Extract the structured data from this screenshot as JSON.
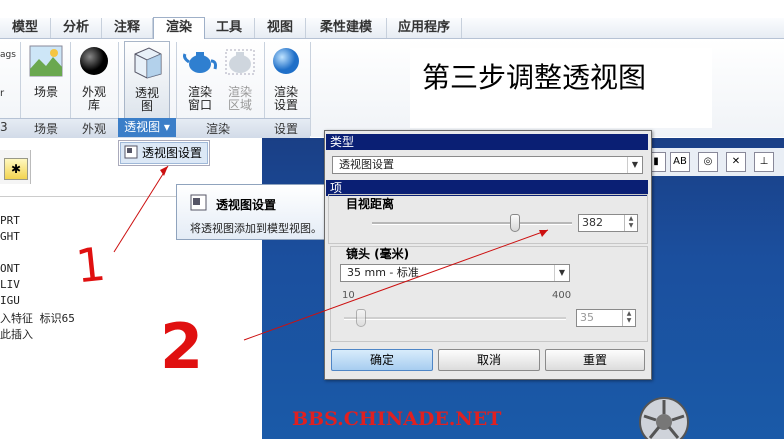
{
  "ribbon_tabs": [
    "模型",
    "分析",
    "注释",
    "渲染",
    "工具",
    "视图",
    "柔性建模",
    "应用程序"
  ],
  "ribbon_buttons": {
    "scene": "场景",
    "appearance": "外观\n库",
    "perspective": "透视\n图",
    "render_window": "渲染\n窗口",
    "render_region": "渲染\n区域",
    "render_settings": "渲染\n设置"
  },
  "left_edge_fragments": {
    "ags": "ags",
    "r": "r",
    "num": "3"
  },
  "group_labels": {
    "scene": "场景",
    "appearance": "外观",
    "perspective": "透视图 ▾",
    "render": "渲染",
    "settings": "设置"
  },
  "annotation_title": "第三步调整透视图",
  "dropdown_item": "透视图设置",
  "tooltip": {
    "title": "透视图设置",
    "desc": "将透视图添加到模型视图。"
  },
  "tree_lines": [
    "PRT",
    "GHT",
    "",
    "ONT",
    "LIV",
    "IGU",
    "入特征 标识65",
    "此插入"
  ],
  "handwritten": {
    "one": "1",
    "two": "2"
  },
  "watermark": "BBS.CHINADE.NET",
  "dialog": {
    "header_type": "类型",
    "type_value": "透视图设置",
    "header_options": "项",
    "eye_distance_label": "目视距离",
    "eye_distance_value": "382",
    "eye_distance_fraction": 0.9,
    "lens_label": "镜头 (毫米)",
    "lens_value": "35 mm - 标准",
    "lens_min": "10",
    "lens_max": "400",
    "focal_value": "35",
    "ok": "确定",
    "cancel": "取消",
    "reset": "重置"
  },
  "colors": {
    "dialog_header": "#0a1f74",
    "viewport": "#1b4f9e",
    "annotation": "#e01010",
    "watermark": "#e02020"
  }
}
